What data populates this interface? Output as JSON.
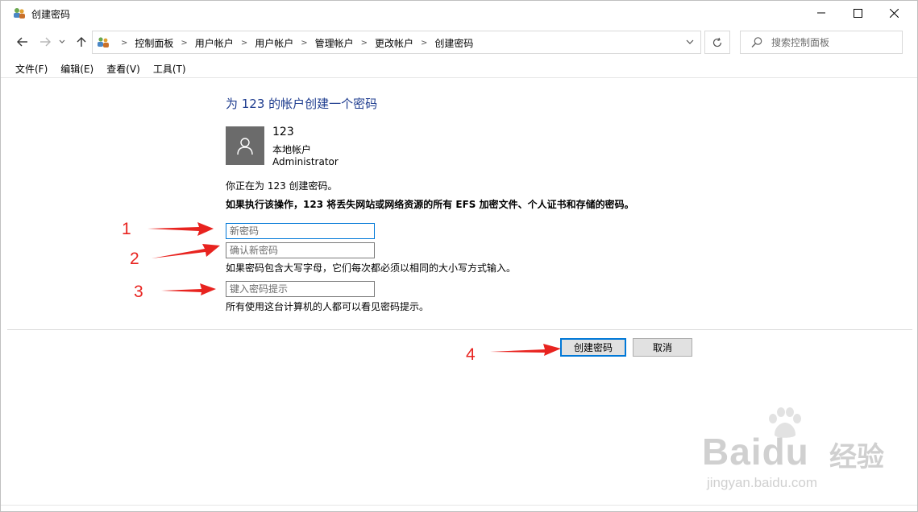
{
  "window": {
    "title": "创建密码",
    "icon": "users-control-panel-icon"
  },
  "address": {
    "crumbs": [
      "控制面板",
      "用户帐户",
      "用户帐户",
      "管理帐户",
      "更改帐户",
      "创建密码"
    ]
  },
  "search": {
    "placeholder": "搜索控制面板"
  },
  "menu": {
    "file": "文件(F)",
    "edit": "编辑(E)",
    "view": "查看(V)",
    "tools": "工具(T)"
  },
  "main": {
    "heading": "为 123 的帐户创建一个密码",
    "account": {
      "name": "123",
      "type": "本地帐户",
      "role": "Administrator"
    },
    "creating_line": "你正在为 123 创建密码。",
    "warning_line": "如果执行该操作，123 将丢失网站或网络资源的所有 EFS 加密文件、个人证书和存储的密码。",
    "new_password_placeholder": "新密码",
    "confirm_password_placeholder": "确认新密码",
    "case_note": "如果密码包含大写字母，它们每次都必须以相同的大小写方式输入。",
    "hint_placeholder": "键入密码提示",
    "hint_note": "所有使用这台计算机的人都可以看见密码提示。"
  },
  "buttons": {
    "create": "创建密码",
    "cancel": "取消"
  },
  "annotations": {
    "n1": "1",
    "n2": "2",
    "n3": "3",
    "n4": "4",
    "color": "#e8231f"
  },
  "watermark": {
    "brand": "Baidu",
    "brand_cn": "经验",
    "url": "jingyan.baidu.com"
  },
  "colors": {
    "heading": "#1e3c8f",
    "focus": "#0078d7",
    "avatar_bg": "#6b6b6b"
  }
}
